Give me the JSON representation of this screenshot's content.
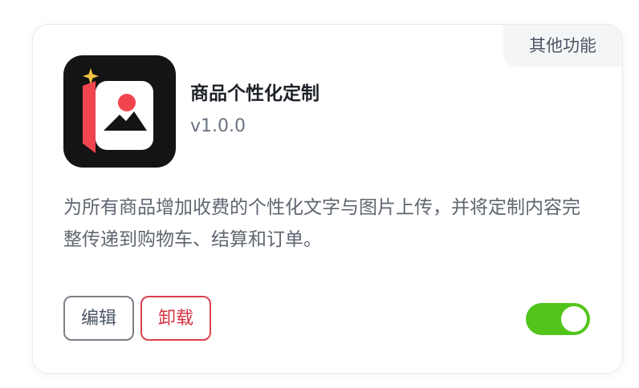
{
  "card": {
    "category_tag": "其他功能",
    "app_name": "商品个性化定制",
    "app_version": "v1.0.0",
    "description": "为所有商品增加收费的个性化文字与图片上传，并将定制内容完整传递到购物车、结算和订单。",
    "edit_label": "编辑",
    "uninstall_label": "卸载",
    "enabled": true,
    "icon": "personalized-image-product-icon"
  },
  "colors": {
    "toggle_on": "#52c41a",
    "danger": "#d63343",
    "icon_bg": "#141414",
    "icon_accent": "#f0444f",
    "sparkle": "#f6c343"
  }
}
